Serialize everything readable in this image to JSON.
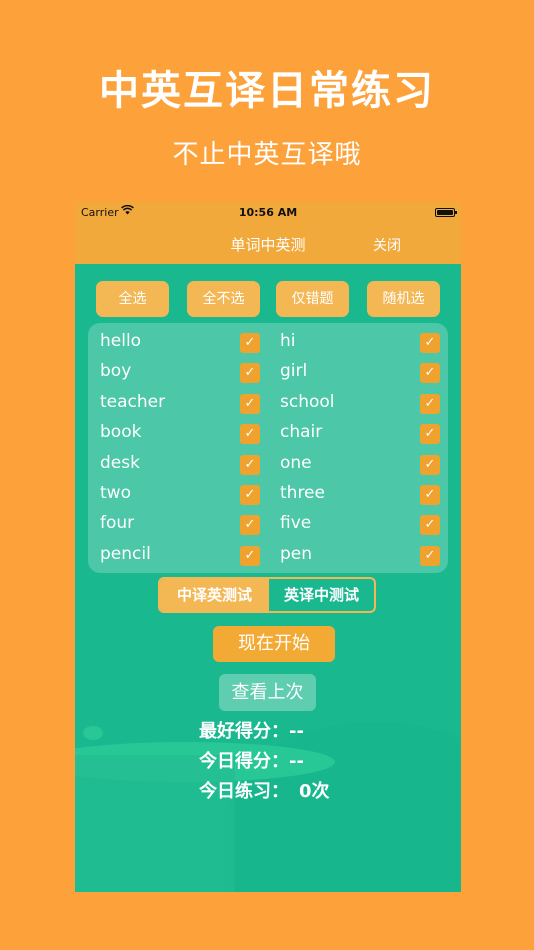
{
  "promo": {
    "title": "中英互译日常练习",
    "subtitle": "不止中英互译哦"
  },
  "status_bar": {
    "carrier": "Carrier",
    "time": "10:56 AM"
  },
  "nav": {
    "title": "单词中英测",
    "close_label": "关闭"
  },
  "filters": [
    "全选",
    "全不选",
    "仅错题",
    "随机选"
  ],
  "check_mark": "✓",
  "words": [
    {
      "left": "hello",
      "right": "hi"
    },
    {
      "left": "boy",
      "right": "girl"
    },
    {
      "left": "teacher",
      "right": "school"
    },
    {
      "left": "book",
      "right": "chair"
    },
    {
      "left": "desk",
      "right": "one"
    },
    {
      "left": "two",
      "right": "three"
    },
    {
      "left": "four",
      "right": "five"
    },
    {
      "left": "pencil",
      "right": "pen"
    }
  ],
  "all_checked": true,
  "modes": {
    "selected": "中译英测试",
    "other": "英译中测试"
  },
  "start_label": "现在开始",
  "history_label": "查看上次",
  "stats": {
    "best_label": "最好得分：",
    "best_value": "--",
    "today_label": "今日得分：",
    "today_value": "--",
    "practice_label": "今日练习：",
    "practice_value": "0次"
  },
  "colors": {
    "page_bg": "#FDA13A",
    "accent": "#F2A93B",
    "app_bg": "#1AB88F",
    "check": "#F0A22E"
  }
}
